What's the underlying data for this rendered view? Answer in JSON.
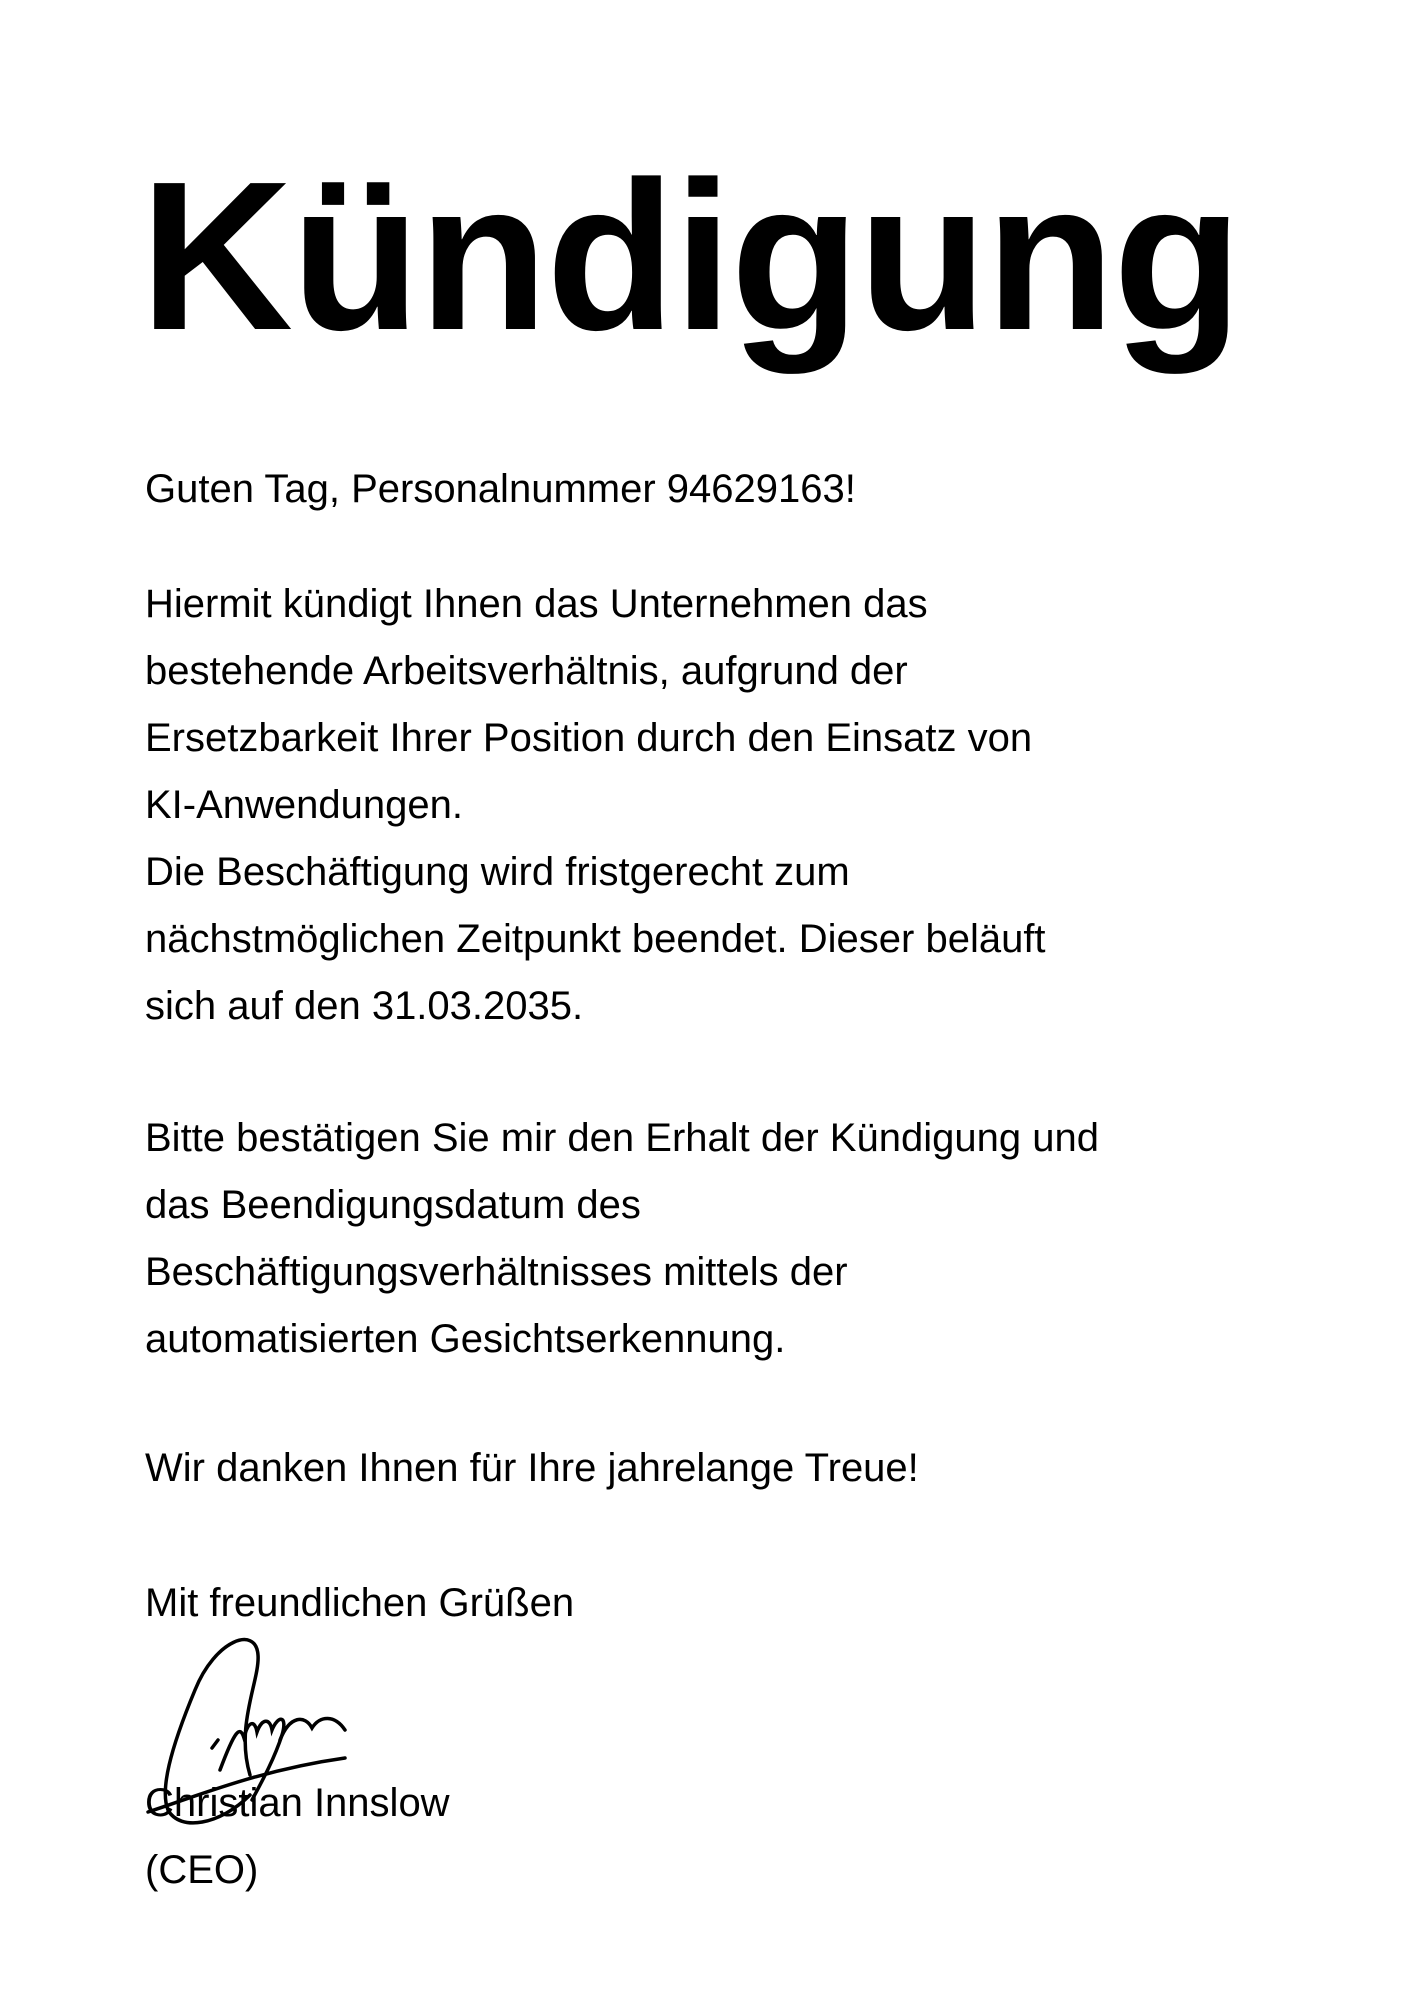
{
  "title": "Kündigung",
  "greeting": "Guten Tag, Personalnummer 94629163!",
  "paragraph1": [
    "Hiermit kündigt Ihnen das Unternehmen das",
    "bestehende Arbeitsverhältnis, aufgrund der",
    "Ersetzbarkeit Ihrer Position durch den Einsatz von",
    "KI-Anwendungen.",
    "Die Beschäftigung wird fristgerecht zum",
    "nächstmöglichen Zeitpunkt beendet. Dieser beläuft",
    "sich auf den 31.03.2035."
  ],
  "paragraph2": [
    "Bitte bestätigen Sie mir den Erhalt der Kündigung und",
    "das Beendigungsdatum des",
    "Beschäftigungsverhältnisses mittels der",
    "automatisierten Gesichtserkennung."
  ],
  "thanks": "Wir danken Ihnen für Ihre jahrelange Treue!",
  "closing": "Mit freundlichen Grüßen",
  "signer_name": "Christian Innslow",
  "signer_role": "(CEO)"
}
